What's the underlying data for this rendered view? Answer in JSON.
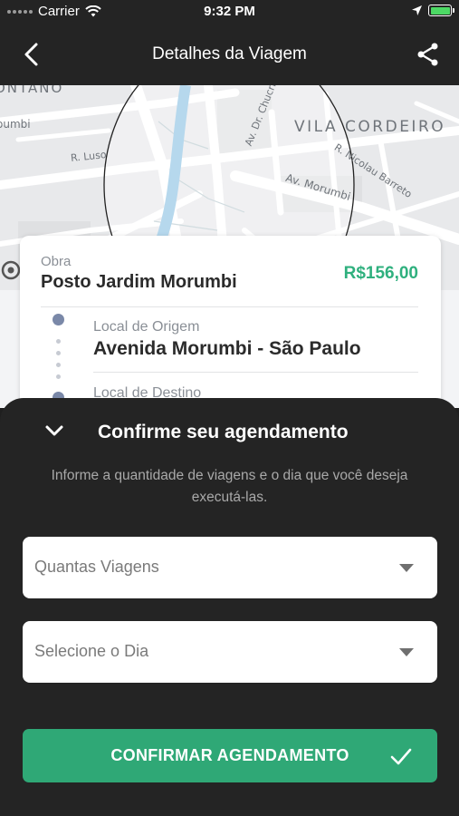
{
  "status_bar": {
    "carrier": "Carrier",
    "time": "9:32 PM"
  },
  "nav": {
    "title": "Detalhes da Viagem",
    "back_icon": "chevron-left-icon",
    "share_icon": "share-icon"
  },
  "map": {
    "labels": {
      "ontano": "ONTANO",
      "vila_cordeiro": "VILA CORDEIRO",
      "av_dr_chucri": "Av. Dr. Chucri",
      "r_nicolau_barreto": "R. Nicolau Barreto",
      "r_luso": "R. Luso",
      "av_morumbi": "Av. Morumbi"
    }
  },
  "trip": {
    "obra_label": "Obra",
    "obra_name": "Posto Jardim Morumbi",
    "price": "R$156,00",
    "origin_label": "Local de Origem",
    "origin_value": "Avenida Morumbi - São Paulo",
    "destination_label": "Local de Destino"
  },
  "sheet": {
    "title": "Confirme seu agendamento",
    "description": "Informe a quantidade de viagens e o dia que você deseja executá-las.",
    "trips_placeholder": "Quantas Viagens",
    "day_placeholder": "Selecione o Dia",
    "confirm_label": "CONFIRMAR AGENDAMENTO"
  },
  "colors": {
    "accent_green": "#2fa876",
    "price_green": "#2fb07e",
    "dark_bg": "#242424"
  }
}
